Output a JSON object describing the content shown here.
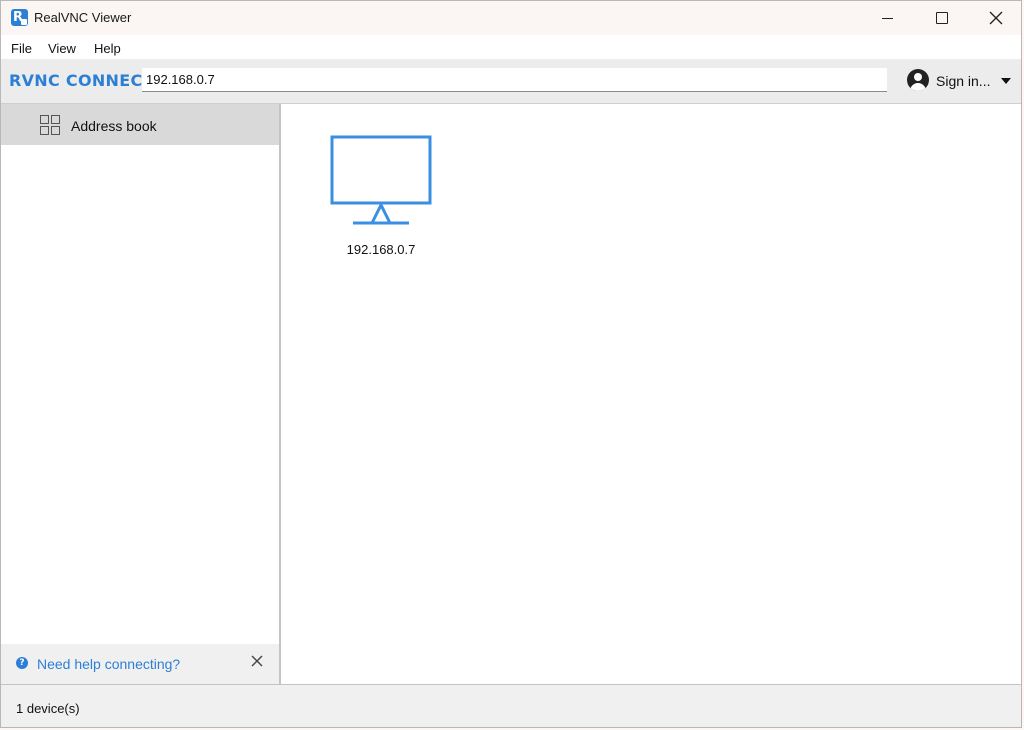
{
  "window": {
    "title": "RealVNC Viewer"
  },
  "menu": {
    "items": [
      {
        "label": "File"
      },
      {
        "label": "View"
      },
      {
        "label": "Help"
      }
    ]
  },
  "toolbar": {
    "brand": "RVNC CONNECT",
    "address_value": "192.168.0.7",
    "signin_label": "Sign in..."
  },
  "sidebar": {
    "items": [
      {
        "label": "Address book",
        "icon": "grid-icon",
        "selected": true
      }
    ],
    "help_link": "Need help connecting?"
  },
  "main": {
    "devices": [
      {
        "label": "192.168.0.7",
        "icon": "monitor-icon"
      }
    ]
  },
  "status": {
    "text": "1 device(s)"
  },
  "colors": {
    "accent": "#2d7fd6",
    "selected_bg": "#d9d9d9",
    "toolbar_bg": "#ececec"
  }
}
